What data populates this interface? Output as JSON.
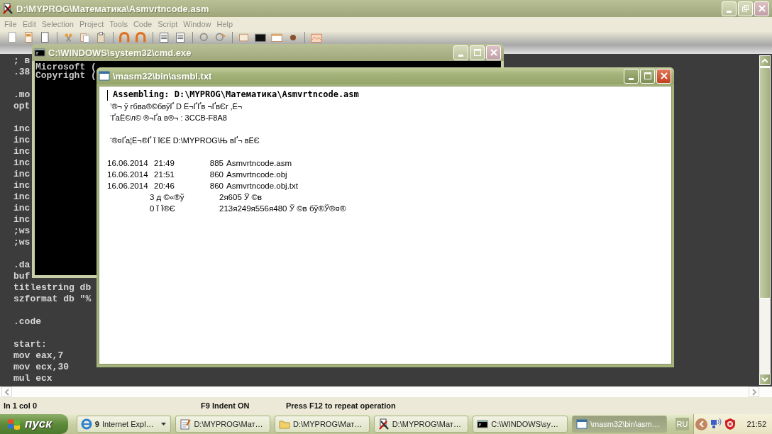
{
  "main_window": {
    "title": "D:\\MYPROG\\Математика\\Asmvrtncode.asm",
    "active": false,
    "menu": [
      "File",
      "Edit",
      "Selection",
      "Project",
      "Tools",
      "Code",
      "Script",
      "Window",
      "Help"
    ],
    "editor": {
      "blocks": [
        [
          "; в",
          ".38"
        ],
        [
          ".mo",
          "opt"
        ],
        [
          "inc",
          "inc",
          "inc",
          "inc",
          "inc",
          "inc",
          "inc",
          "inc",
          "inc",
          ";ws",
          ";ws"
        ],
        [
          ".da",
          "buf",
          "titlestring db",
          "szformat db \"%"
        ],
        [
          ".code"
        ],
        [
          "start:",
          "mov eax,7",
          "mov ecx,30",
          "mul ecx"
        ]
      ]
    },
    "status_bar": [
      "ln 1 col 0",
      "F9 Indent ON",
      "Press F12 to repeat operation"
    ]
  },
  "cmd_window": {
    "title": "C:\\WINDOWS\\system32\\cmd.exe",
    "active": false,
    "lines": [
      "Microsoft (",
      "Copyright ("
    ]
  },
  "text_window": {
    "title": "\\masm32\\bin\\asmbl.txt",
    "active": true,
    "paragraphs": [
      [
        {
          "kind": "heading",
          "text": "Assembling: D:\\MYPROG\\Математика\\Asmvrtncode.asm"
        },
        {
          "kind": "line",
          "text": "’®¬ ў гбва®©бвўҐ D Ё¬ҐҐв ¬ҐвЄг ‚Ё¬"
        },
        {
          "kind": "line",
          "text": "‘ҐаЁ©л© ®¬Ґа в®¬ : 3CCB-F8A8"
        }
      ],
      [
        {
          "kind": "line",
          "text": "‘®¤Ґа¦Ё¬®Ґ Ї ЇЄЁ D:\\MYPROG\\Њ вҐ¬ вЁЄ"
        }
      ],
      [
        {
          "kind": "file",
          "date": "16.06.2014",
          "time": "21:49",
          "size": "885",
          "name": "Asmvrtncode.asm"
        },
        {
          "kind": "file",
          "date": "16.06.2014",
          "time": "21:51",
          "size": "860",
          "name": "Asmvrtncode.obj"
        },
        {
          "kind": "file",
          "date": "16.06.2014",
          "time": "20:46",
          "size": "860",
          "name": "Asmvrtncode.obj.txt"
        },
        {
          "kind": "summary",
          "count": "3 д ©«®ў",
          "amount": "2я605 Ў ©в"
        },
        {
          "kind": "summary",
          "count": "0 Ї Ї®Є",
          "amount": "213я249я556я480 Ў ©в бў®Ў®¤®"
        }
      ]
    ]
  },
  "taskbar": {
    "start": "пуск",
    "buttons": [
      {
        "kind": "browser",
        "count": "9",
        "label": "Internet Expl…",
        "selected": false
      },
      {
        "kind": "notepad",
        "label": "D:\\MYPROG\\Мат…",
        "selected": false
      },
      {
        "kind": "folder",
        "label": "D:\\MYPROG\\Мат…",
        "selected": false
      },
      {
        "kind": "editor",
        "label": "D:\\MYPROG\\Мат…",
        "selected": false
      },
      {
        "kind": "console",
        "label": "C:\\WINDOWS\\sy…",
        "selected": false
      },
      {
        "kind": "window",
        "label": "\\masm32\\bin\\asm…",
        "selected": true
      }
    ],
    "language": "RU",
    "clock": "21:52"
  }
}
